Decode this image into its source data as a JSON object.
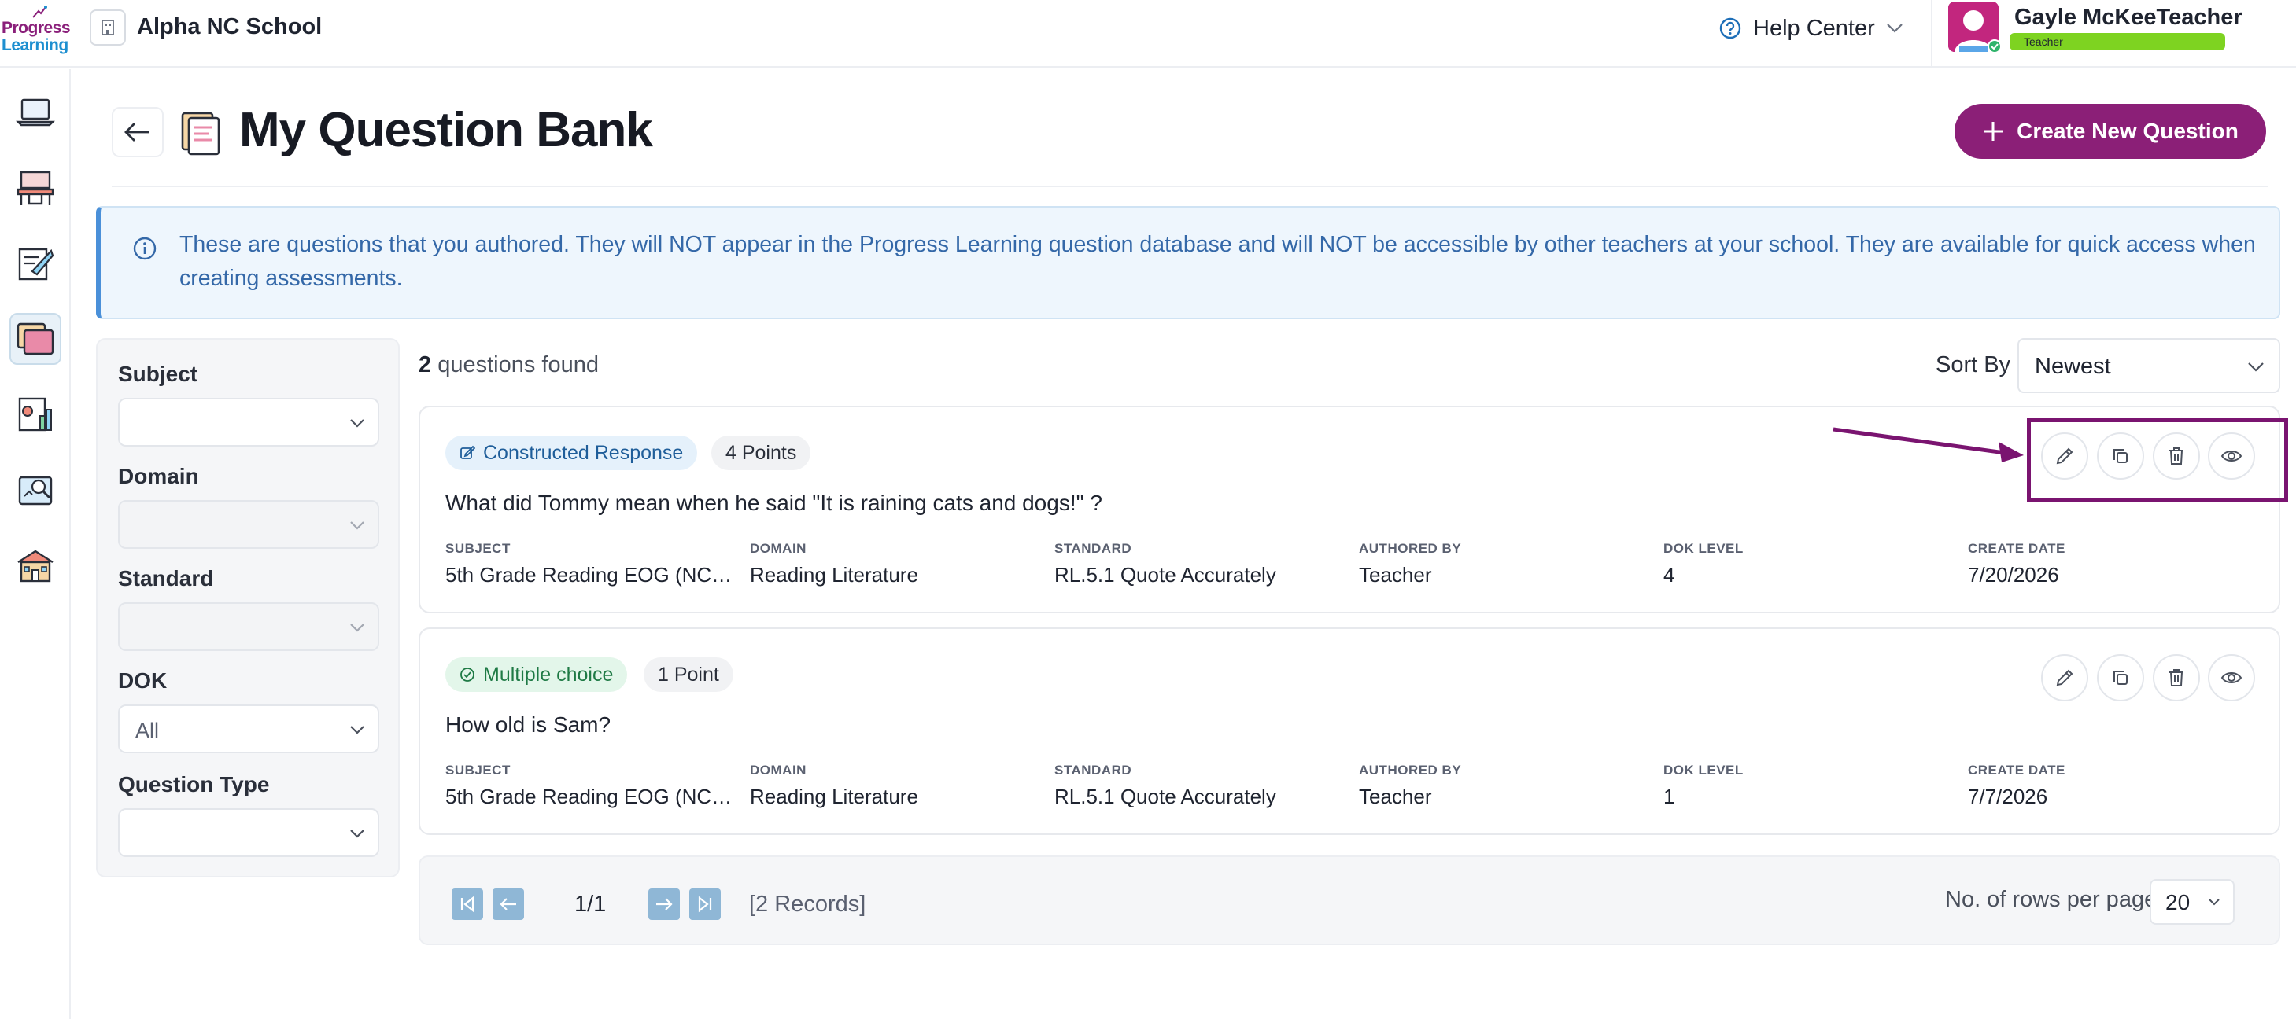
{
  "brand": {
    "line1": "Progress",
    "line2": "Learning"
  },
  "topbar": {
    "school_name": "Alpha NC School",
    "help_label": "Help Center",
    "user_name": "Gayle McKeeTeacher",
    "user_role": "Teacher"
  },
  "header": {
    "title": "My Question Bank",
    "create_label": "Create New Question"
  },
  "info_banner": {
    "text": "These are questions that you authored. They will NOT appear in the Progress Learning question database and will NOT be accessible by other teachers at your school. They are available for quick access when creating assessments."
  },
  "filters": {
    "subject": {
      "label": "Subject",
      "value": ""
    },
    "domain": {
      "label": "Domain",
      "value": ""
    },
    "standard": {
      "label": "Standard",
      "value": ""
    },
    "dok": {
      "label": "DOK",
      "value": "All"
    },
    "question_type": {
      "label": "Question Type",
      "value": ""
    }
  },
  "results": {
    "count": "2",
    "count_suffix": "questions found",
    "sort_label": "Sort By",
    "sort_value": "Newest"
  },
  "meta_labels": {
    "subject": "SUBJECT",
    "domain": "DOMAIN",
    "standard": "STANDARD",
    "authored_by": "AUTHORED BY",
    "dok_level": "DOK LEVEL",
    "create_date": "CREATE DATE"
  },
  "questions": [
    {
      "type": "Constructed Response",
      "points": "4 Points",
      "text": "What did Tommy mean when he said \"It is raining cats and dogs!\" ?",
      "subject": "5th Grade Reading EOG (NCS...",
      "domain": "Reading Literature",
      "standard": "RL.5.1 Quote Accurately",
      "authored_by": "Teacher",
      "dok_level": "4",
      "create_date": "7/20/2026"
    },
    {
      "type": "Multiple choice",
      "points": "1 Point",
      "text": "How old is Sam?",
      "subject": "5th Grade Reading EOG (NCS...",
      "domain": "Reading Literature",
      "standard": "RL.5.1 Quote Accurately",
      "authored_by": "Teacher",
      "dok_level": "1",
      "create_date": "7/7/2026"
    }
  ],
  "pagination": {
    "page": "1/1",
    "records": "[2 Records]",
    "rows_label": "No. of rows per page",
    "rows_value": "20"
  },
  "icons": {
    "rail": [
      "laptop-icon",
      "classroom-icon",
      "assignment-icon",
      "question-bank-icon",
      "reports-icon",
      "study-icon",
      "school-icon"
    ],
    "actions": [
      "pencil-icon",
      "copy-icon",
      "trash-icon",
      "eye-icon"
    ]
  },
  "colors": {
    "brand_purple": "#8b1f77",
    "annotation": "#7a1470",
    "info_text": "#3468a8",
    "role_badge": "#7ed321"
  }
}
